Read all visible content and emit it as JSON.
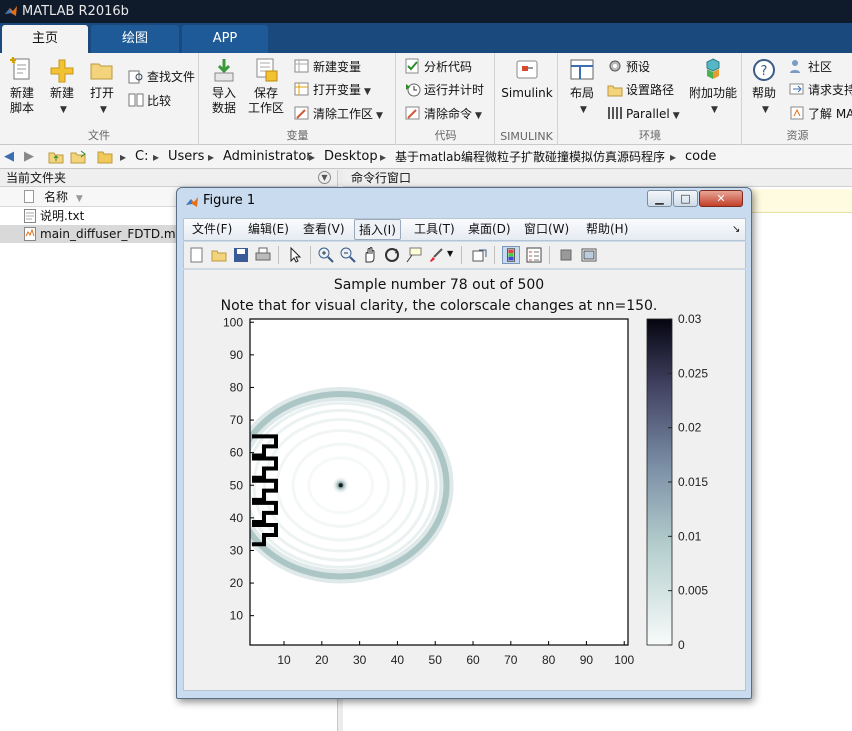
{
  "app": {
    "title": "MATLAB R2016b"
  },
  "tabs": [
    {
      "label": "主页",
      "active": true
    },
    {
      "label": "绘图",
      "active": false
    },
    {
      "label": "APP",
      "active": false
    }
  ],
  "ribbon": {
    "file": {
      "label": "文件",
      "new_script": "新建\n脚本",
      "new": "新建",
      "open": "打开",
      "find_files": "查找文件",
      "compare": "比较"
    },
    "variable": {
      "label": "变量",
      "import": "导入\n数据",
      "save_workspace": "保存\n工作区",
      "new_variable": "新建变量",
      "open_variable": "打开变量",
      "clear_workspace": "清除工作区"
    },
    "code": {
      "label": "代码",
      "analyze": "分析代码",
      "run_time": "运行并计时",
      "clear_commands": "清除命令"
    },
    "simulink": {
      "label": "SIMULINK",
      "button": "Simulink"
    },
    "environment": {
      "label": "环境",
      "layout": "布局",
      "preferences": "预设",
      "set_path": "设置路径",
      "parallel": "Parallel",
      "addons": "附加功能"
    },
    "resources": {
      "label": "资源",
      "help": "帮助",
      "community": "社区",
      "request_support": "请求支持",
      "learn_matlab": "了解 MA"
    }
  },
  "address": {
    "crumbs": [
      "C:",
      "Users",
      "Administrator",
      "Desktop",
      "基于matlab编程微粒子扩散碰撞模拟仿真源码程序",
      "code"
    ]
  },
  "file_panel": {
    "title": "当前文件夹",
    "column": "名称",
    "files": [
      {
        "name": "说明.txt",
        "selected": false
      },
      {
        "name": "main_diffuser_FDTD.m",
        "selected": true
      }
    ]
  },
  "command_panel": {
    "title": "命令行窗口"
  },
  "figure": {
    "title": "Figure 1",
    "menu": [
      {
        "label": "文件(F)"
      },
      {
        "label": "编辑(E)"
      },
      {
        "label": "查看(V)"
      },
      {
        "label": "插入(I)"
      },
      {
        "label": "工具(T)"
      },
      {
        "label": "桌面(D)"
      },
      {
        "label": "窗口(W)"
      },
      {
        "label": "帮助(H)"
      }
    ],
    "plot_title_1": "Sample number 78 out of 500",
    "plot_title_2": "Note that for visual clarity, the colorscale changes at nn=150."
  },
  "chart_data": {
    "type": "heatmap",
    "title": "Sample number 78 out of 500",
    "subtitle": "Note that for visual clarity, the colorscale changes at nn=150.",
    "xlim": [
      1,
      101
    ],
    "ylim": [
      1,
      101
    ],
    "x_ticks": [
      10,
      20,
      30,
      40,
      50,
      60,
      70,
      80,
      90,
      100
    ],
    "y_ticks": [
      10,
      20,
      30,
      40,
      50,
      60,
      70,
      80,
      90,
      100
    ],
    "colorbar": {
      "min": 0,
      "max": 0.03,
      "ticks": [
        "0",
        "0.005",
        "0.01",
        "0.015",
        "0.02",
        "0.025",
        "0.03"
      ]
    },
    "source": {
      "x": 25,
      "y": 50
    },
    "wavefront_radius": 28,
    "wall_y_range": [
      31,
      65
    ],
    "colors": {
      "low": "#f7fbfa",
      "mid": "#7fa9a8",
      "high": "#050510"
    }
  }
}
